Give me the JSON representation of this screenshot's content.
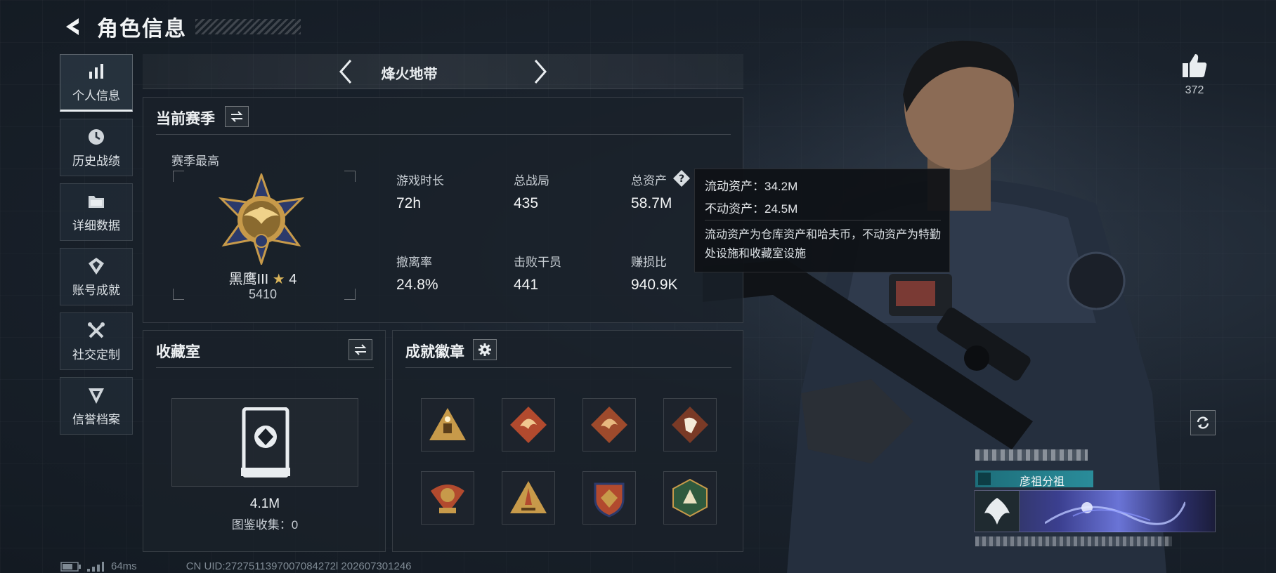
{
  "header": {
    "title": "角色信息"
  },
  "sidebar": {
    "items": [
      {
        "label": "个人信息",
        "icon": "bar-chart-icon",
        "active": true
      },
      {
        "label": "历史战绩",
        "icon": "history-icon"
      },
      {
        "label": "详细数据",
        "icon": "folder-icon"
      },
      {
        "label": "账号成就",
        "icon": "achievement-icon"
      },
      {
        "label": "社交定制",
        "icon": "tools-icon"
      },
      {
        "label": "信誉档案",
        "icon": "shield-icon"
      }
    ]
  },
  "mode": {
    "title": "烽火地带"
  },
  "season": {
    "title": "当前赛季",
    "best_label": "赛季最高",
    "rank_name": "黑鹰III",
    "rank_stars": "4",
    "rank_score": "5410",
    "stats": [
      {
        "label": "游戏时长",
        "value": "72h"
      },
      {
        "label": "总战局",
        "value": "435"
      },
      {
        "label": "总资产",
        "value": "58.7M"
      },
      {
        "label": "撤离率",
        "value": "24.8%"
      },
      {
        "label": "击败干员",
        "value": "441"
      },
      {
        "label": "赚损比",
        "value": "940.9K"
      }
    ]
  },
  "tooltip": {
    "line1": "流动资产：34.2M",
    "line2": "不动资产：24.5M",
    "desc": "流动资产为仓库资产和哈夫币，不动资产为特勤处设施和收藏室设施"
  },
  "collection": {
    "title": "收藏室",
    "value": "4.1M",
    "codex_label": "图鉴收集：0"
  },
  "achievements": {
    "title": "成就徽章",
    "badge_count": 8
  },
  "social": {
    "likes": "372"
  },
  "profile_card": {
    "group_name": "彦祖分祖"
  },
  "status_bar": {
    "ping": "64ms",
    "uid": "CN UID:2727511397007084272l 202607301246"
  },
  "colors": {
    "accent": "#e9edf0",
    "panel": "#1a2129",
    "badge_gold": "#c79a4a",
    "badge_red": "#b24a2e"
  }
}
